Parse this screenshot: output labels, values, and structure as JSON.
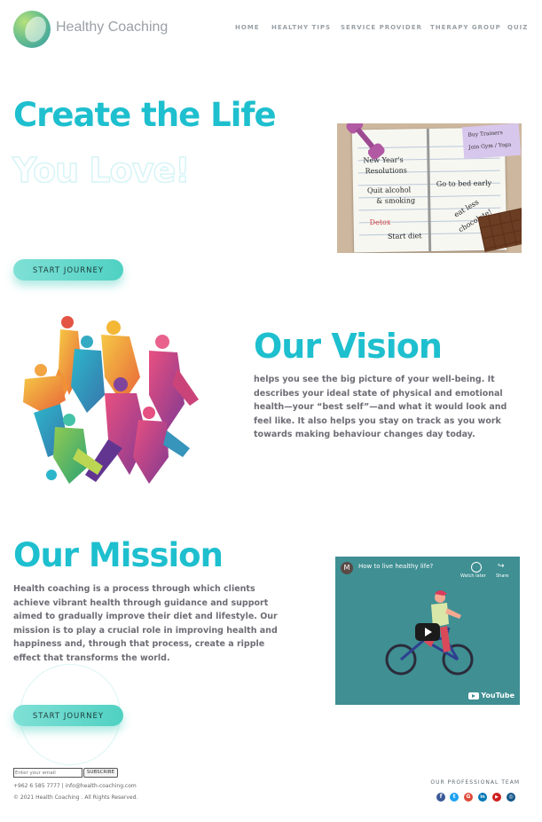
{
  "brand": {
    "name": "Healthy Coaching"
  },
  "nav": {
    "items": [
      "HOME",
      "HEALTHY TIPS",
      "SERVICE PROVIDER",
      "THERAPY GROUP",
      "QUIZ"
    ]
  },
  "hero": {
    "title_line1": "Create the Life",
    "title_line2": "You Love!",
    "cta": "START JOURNEY",
    "image": {
      "notes": [
        "New Year's",
        "Resolutions",
        "Quit alcohol",
        "& smoking",
        "Detox",
        "Start diet",
        "Go to bed early",
        "eat less",
        "chocolate!"
      ],
      "sticky": [
        "Buy Trainers",
        "Join Gym / Yoga"
      ]
    }
  },
  "vision": {
    "title": "Our Vision",
    "text": "helps you see the big picture of your well-being. It describes your ideal state of physical and emotional health—your “best self”—and what it would look and feel like. It also helps you stay on track as you work towards making behaviour changes day today."
  },
  "mission": {
    "title": "Our Mission",
    "text": "Health coaching is a process through which clients achieve vibrant health through guidance and support aimed to gradually improve their diet and lifestyle. Our mission is to play a crucial role in improving health and happiness and, through that process, create a ripple effect that transforms the world.",
    "cta": "START JOURNEY"
  },
  "video": {
    "channel_initial": "M",
    "title": "How to live healthy life?",
    "watch_later": "Watch later",
    "share": "Share",
    "brand": "YouTube"
  },
  "footer": {
    "email_placeholder": "Enter your email",
    "subscribe": "SUBSCRIBE",
    "contact": "+962 6 585 7777 | info@health-coaching.com",
    "copyright": "© 2021 Health Coaching . All Rights Reserved.",
    "team_heading": "OUR PROFESSIONAL TEAM",
    "social": [
      {
        "name": "facebook-icon",
        "glyph": "f",
        "color": "#3b5998"
      },
      {
        "name": "twitter-icon",
        "glyph": "t",
        "color": "#1da1f2"
      },
      {
        "name": "google-plus-icon",
        "glyph": "G",
        "color": "#dd4b39"
      },
      {
        "name": "linkedin-icon",
        "glyph": "in",
        "color": "#0077b5"
      },
      {
        "name": "youtube-icon",
        "glyph": "▶",
        "color": "#cd201f"
      },
      {
        "name": "instagram-icon",
        "glyph": "◎",
        "color": "#125688"
      }
    ]
  },
  "colors": {
    "accent": "#1ebfce",
    "cta": "#4fd1c2",
    "text": "#6d6d75"
  }
}
